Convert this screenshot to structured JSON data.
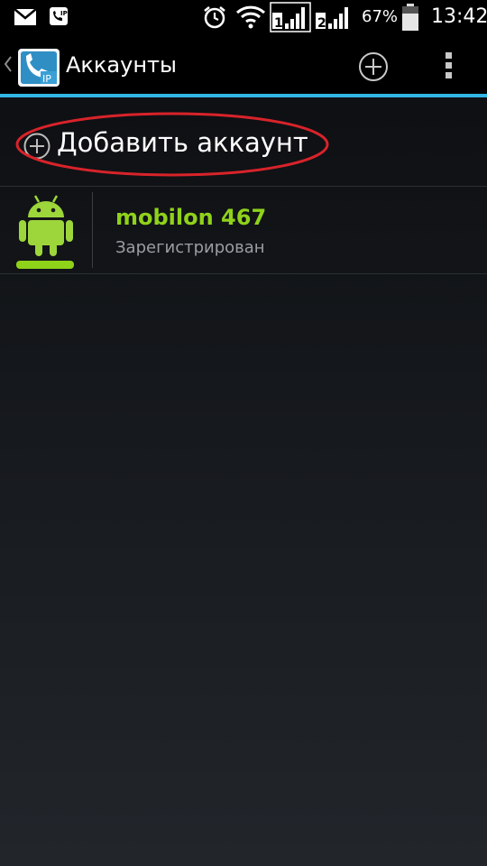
{
  "status_bar": {
    "battery_percent": "67%",
    "time": "13:42",
    "sim1_label": "1",
    "sim2_label": "2",
    "app_notification_label": "IP"
  },
  "action_bar": {
    "title": "Аккаунты",
    "app_icon_label": "IP",
    "accent_color": "#33b5e5"
  },
  "add_account": {
    "label": "Добавить аккаунт",
    "highlight_color": "#d8232a"
  },
  "accounts": [
    {
      "name": "mobilon 467",
      "status": "Зарегистрирован",
      "status_color": "#8fd21a",
      "avatar_icon": "android-robot-icon"
    }
  ]
}
